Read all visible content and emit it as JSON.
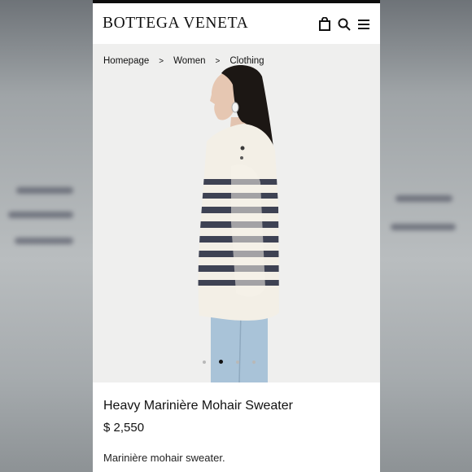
{
  "brand": "BOTTEGA VENETA",
  "header_icons": [
    "bag-icon",
    "search-icon",
    "menu-icon"
  ],
  "breadcrumb": {
    "items": [
      "Homepage",
      "Women",
      "Clothing"
    ],
    "separator": ">"
  },
  "carousel": {
    "count": 4,
    "active_index": 1
  },
  "product": {
    "title": "Heavy Marinière Mohair Sweater",
    "price": "$ 2,550",
    "description": "Marinière mohair sweater."
  },
  "colors": {
    "header_bar": "#0d0d0d",
    "hero_bg": "#efefee",
    "sweater": "#f3efe6",
    "stripe": "#2f3447",
    "denim": "#a9c3d8"
  }
}
